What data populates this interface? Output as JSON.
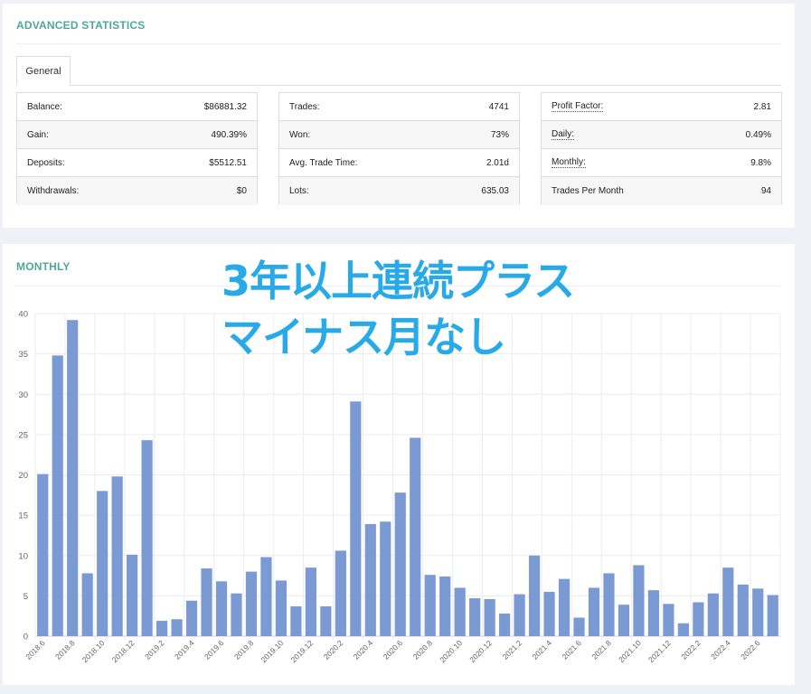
{
  "stats": {
    "title": "ADVANCED STATISTICS",
    "tab_label": "General",
    "table1": [
      {
        "label": "Balance:",
        "value": "$86881.32"
      },
      {
        "label": "Gain:",
        "value": "490.39%"
      },
      {
        "label": "Deposits:",
        "value": "$5512.51"
      },
      {
        "label": "Withdrawals:",
        "value": "$0"
      }
    ],
    "table2": [
      {
        "label": "Trades:",
        "value": "4741"
      },
      {
        "label": "Won:",
        "value": "73%"
      },
      {
        "label": "Avg. Trade Time:",
        "value": "2.01d"
      },
      {
        "label": "Lots:",
        "value": "635.03"
      }
    ],
    "table3": [
      {
        "label": "Profit Factor:",
        "value": "2.81"
      },
      {
        "label": "Daily:",
        "value": "0.49%"
      },
      {
        "label": "Monthly:",
        "value": "9.8%"
      },
      {
        "label": "Trades Per Month",
        "value": "94"
      }
    ]
  },
  "monthly": {
    "title": "MONTHLY"
  },
  "overlay": {
    "line1": "3年以上連続プラス",
    "line2": "マイナス月なし"
  },
  "colors": {
    "bar": "#7b9ad4",
    "accent": "#4ea89a",
    "overlay": "#29aae8"
  },
  "chart_data": {
    "type": "bar",
    "categories": [
      "2018.6",
      "2018.7",
      "2018.8",
      "2018.9",
      "2018.10",
      "2018.11",
      "2018.12",
      "2019.1",
      "2019.2",
      "2019.3",
      "2019.4",
      "2019.5",
      "2019.6",
      "2019.7",
      "2019.8",
      "2019.9",
      "2019.10",
      "2019.11",
      "2019.12",
      "2020.1",
      "2020.2",
      "2020.3",
      "2020.4",
      "2020.5",
      "2020.6",
      "2020.7",
      "2020.8",
      "2020.9",
      "2020.10",
      "2020.11",
      "2020.12",
      "2021.1",
      "2021.2",
      "2021.3",
      "2021.4",
      "2021.5",
      "2021.6",
      "2021.7",
      "2021.8",
      "2021.9",
      "2021.10",
      "2021.11",
      "2021.12",
      "2022.1",
      "2022.2",
      "2022.3",
      "2022.4",
      "2022.5",
      "2022.6",
      "2022.7"
    ],
    "values": [
      20.1,
      34.8,
      39.2,
      7.8,
      18.0,
      19.8,
      10.1,
      24.3,
      1.9,
      2.1,
      4.4,
      8.4,
      6.8,
      5.3,
      8.0,
      9.8,
      6.9,
      3.7,
      8.5,
      3.7,
      10.6,
      29.1,
      13.9,
      14.2,
      17.8,
      24.6,
      7.6,
      7.4,
      6.0,
      4.7,
      4.6,
      2.8,
      5.2,
      10.0,
      5.5,
      7.1,
      2.3,
      6.0,
      7.8,
      3.9,
      8.8,
      5.7,
      4.0,
      1.6,
      4.2,
      5.3,
      8.5,
      6.4,
      5.9,
      5.1
    ],
    "x_tick_labels": [
      "2018.6",
      "2018.8",
      "2018.10",
      "2018.12",
      "2019.2",
      "2019.4",
      "2019.6",
      "2019.8",
      "2019.10",
      "2019.12",
      "2020.2",
      "2020.4",
      "2020.6",
      "2020.8",
      "2020.10",
      "2020.12",
      "2021.2",
      "2021.4",
      "2021.6",
      "2021.8",
      "2021.10",
      "2021.12",
      "2022.2",
      "2022.4",
      "2022.6"
    ],
    "y_ticks": [
      "0",
      "5",
      "10",
      "15",
      "20",
      "25",
      "30",
      "35",
      "40"
    ],
    "ylim": [
      0,
      40
    ],
    "grid": true,
    "title": "",
    "xlabel": "",
    "ylabel": ""
  }
}
